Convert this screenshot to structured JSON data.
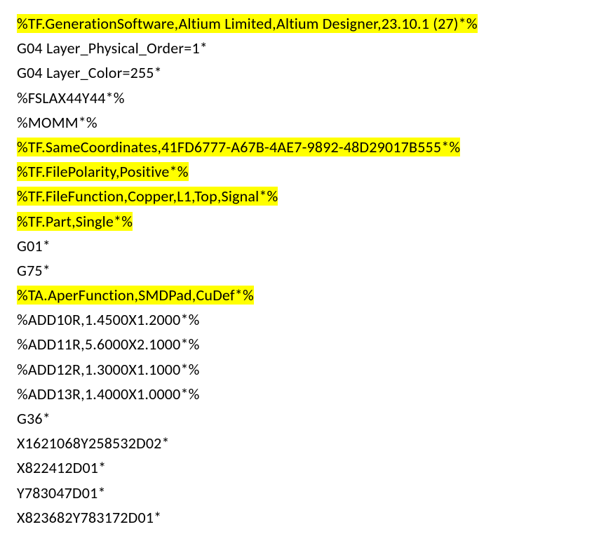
{
  "lines": [
    {
      "text": "%TF.GenerationSoftware,Altium Limited,Altium Designer,23.10.1 (27)*%",
      "highlight": true
    },
    {
      "text": "G04 Layer_Physical_Order=1*",
      "highlight": false
    },
    {
      "text": "G04 Layer_Color=255*",
      "highlight": false
    },
    {
      "text": "%FSLAX44Y44*%",
      "highlight": false
    },
    {
      "text": "%MOMM*%",
      "highlight": false
    },
    {
      "text": "%TF.SameCoordinates,41FD6777-A67B-4AE7-9892-48D29017B555*%",
      "highlight": true
    },
    {
      "text": "%TF.FilePolarity,Positive*%",
      "highlight": true
    },
    {
      "text": "%TF.FileFunction,Copper,L1,Top,Signal*%",
      "highlight": true
    },
    {
      "text": "%TF.Part,Single*%",
      "highlight": true
    },
    {
      "text": "G01*",
      "highlight": false
    },
    {
      "text": "G75*",
      "highlight": false
    },
    {
      "text": "%TA.AperFunction,SMDPad,CuDef*%",
      "highlight": true
    },
    {
      "text": "%ADD10R,1.4500X1.2000*%",
      "highlight": false
    },
    {
      "text": "%ADD11R,5.6000X2.1000*%",
      "highlight": false
    },
    {
      "text": "%ADD12R,1.3000X1.1000*%",
      "highlight": false
    },
    {
      "text": "%ADD13R,1.4000X1.0000*%",
      "highlight": false
    },
    {
      "text": "G36*",
      "highlight": false
    },
    {
      "text": "X1621068Y258532D02*",
      "highlight": false
    },
    {
      "text": "X822412D01*",
      "highlight": false
    },
    {
      "text": "Y783047D01*",
      "highlight": false
    },
    {
      "text": "X823682Y783172D01*",
      "highlight": false
    }
  ]
}
